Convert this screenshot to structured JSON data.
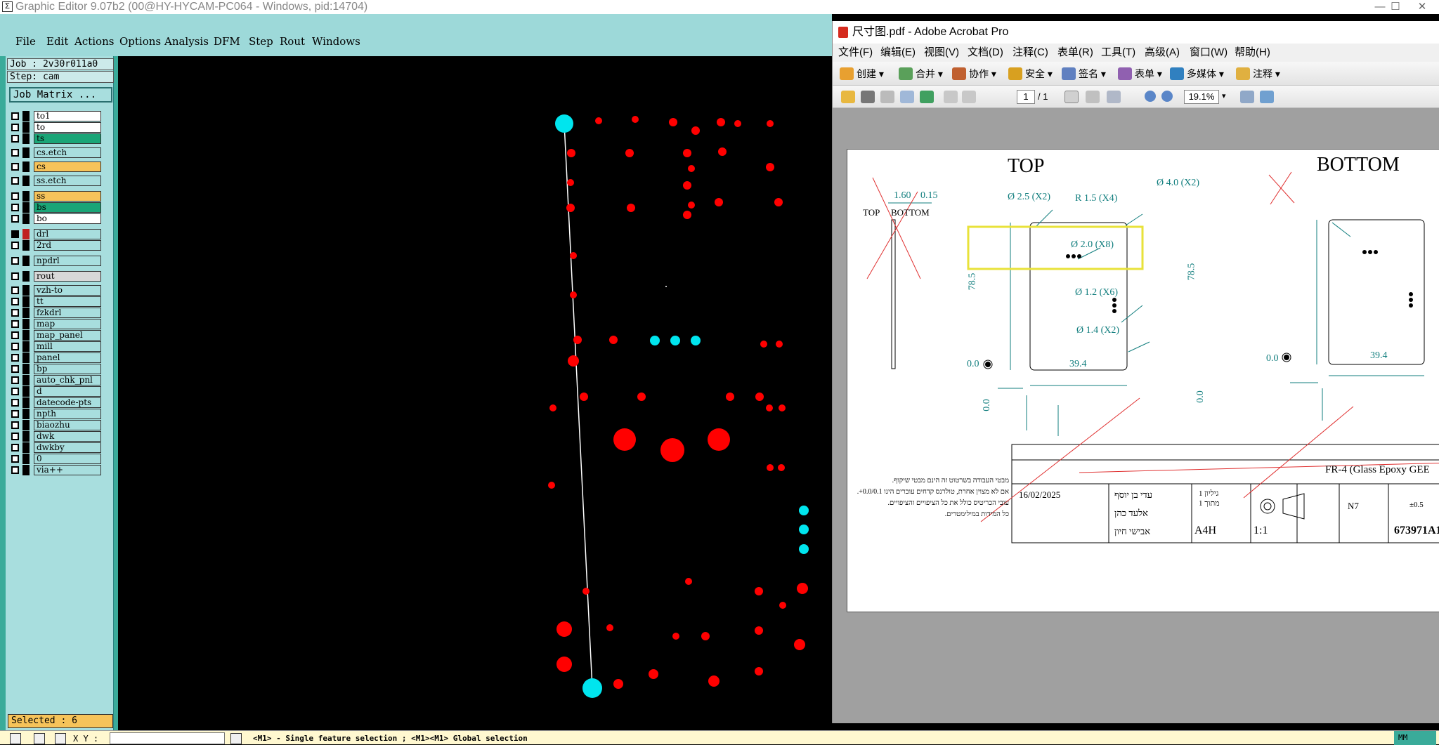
{
  "graphic_editor": {
    "title": "Graphic Editor 9.07b2 (00@HY-HYCAM-PC064 - Windows, pid:14704)",
    "menu": [
      "File",
      "Edit",
      "Actions",
      "Options",
      "Analysis",
      "DFM",
      "Step",
      "Rout",
      "Windows"
    ],
    "job": "Job : 2v30r011a0",
    "step": "Step: cam",
    "job_matrix": "Job Matrix ...",
    "layers": [
      {
        "name": "to1",
        "color": "#ffffff"
      },
      {
        "name": "to",
        "color": "#ffffff"
      },
      {
        "name": "ts",
        "color": "#1aa577"
      },
      {
        "name": "cs.etch",
        "color": "#a8dede"
      },
      {
        "name": "cs",
        "color": "#f6c35a"
      },
      {
        "name": "ss.etch",
        "color": "#a8dede"
      },
      {
        "name": "ss",
        "color": "#f6c35a"
      },
      {
        "name": "bs",
        "color": "#1aa577"
      },
      {
        "name": "bo",
        "color": "#ffffff"
      },
      {
        "name": "drl",
        "color": "#a8dede"
      },
      {
        "name": "2rd",
        "color": "#a8dede"
      },
      {
        "name": "npdrl",
        "color": "#a8dede"
      },
      {
        "name": "rout",
        "color": "#d8d8d8"
      },
      {
        "name": "vzh-to",
        "color": "#a8dede"
      },
      {
        "name": "tt",
        "color": "#a8dede"
      },
      {
        "name": "fzkdrl",
        "color": "#a8dede"
      },
      {
        "name": "map",
        "color": "#a8dede"
      },
      {
        "name": "map_panel",
        "color": "#a8dede"
      },
      {
        "name": "mill",
        "color": "#a8dede"
      },
      {
        "name": "panel",
        "color": "#a8dede"
      },
      {
        "name": "bp",
        "color": "#a8dede"
      },
      {
        "name": "auto_chk_pnl",
        "color": "#a8dede"
      },
      {
        "name": "d",
        "color": "#a8dede"
      },
      {
        "name": "datecode-pts",
        "color": "#a8dede"
      },
      {
        "name": "npth",
        "color": "#a8dede"
      },
      {
        "name": "biaozhu",
        "color": "#a8dede"
      },
      {
        "name": "dwk",
        "color": "#a8dede"
      },
      {
        "name": "dwkby",
        "color": "#a8dede"
      },
      {
        "name": "0",
        "color": "#a8dede"
      },
      {
        "name": "via++",
        "color": "#a8dede"
      }
    ],
    "selected": "Selected : 6",
    "xy_label": "X Y :",
    "status": "<M1> - Single feature selection ; <M1><M1> Global selection",
    "corner_label": "MM"
  },
  "acrobat": {
    "title": "尺寸图.pdf - Adobe Acrobat Pro",
    "menu": [
      "文件(F)",
      "编辑(E)",
      "视图(V)",
      "文档(D)",
      "注释(C)",
      "表单(R)",
      "工具(T)",
      "高级(A)",
      "窗口(W)",
      "帮助(H)"
    ],
    "toolbar": [
      "创建",
      "合并",
      "协作",
      "安全",
      "签名",
      "表单",
      "多媒体",
      "注释"
    ],
    "page_current": "1",
    "page_total": "/ 1",
    "zoom": "19.1%",
    "drawing": {
      "top_heading": "TOP",
      "bottom_heading": "BOTTOM",
      "side_top": "TOP",
      "side_bottom": "BOTTOM",
      "thickness_a": "1.60",
      "thickness_b": "0.15",
      "hole_25": "Ø 2.5 (X2)",
      "radius": "R 1.5 (X4)",
      "hole_20": "Ø 2.0 (X8)",
      "hole_12": "Ø 1.2 (X6)",
      "hole_14": "Ø 1.4 (X2)",
      "hole_40": "Ø 4.0 (X2)",
      "height": "78.5",
      "width": "39.4",
      "origin": "0.0",
      "material": "FR-4 (Glass Epoxy GEE",
      "date": "16/02/2025",
      "name1": "עדי בן יוסף",
      "name2": "אלעד כהן",
      "name3": "אבישי חיון",
      "finish": "N7",
      "sheet_size": "A4H",
      "scale": "1:1",
      "part_no": "673971A1",
      "note1": "מבטי העבודה בשרטוט זה הינם מבטי שיקוף.",
      "note2": "אם לא מצוין אחרת, טולרנס קדחים עוברים הינו 0.0/0.1+.",
      "note3": "עובי הכריטיס כולל את כל הציפויים והציפויים.",
      "note4": "כל המידות במילימטרים.",
      "sheet": "גיליון 1",
      "of": "מתוך 1",
      "general_tol": "±0.5"
    }
  },
  "colors": {
    "teal_bg": "#9dd9d9",
    "panel_green": "#3aab9a",
    "pad_red": "#ff0000",
    "pad_cyan": "#00e5ee",
    "dim_teal": "#0f7d7d",
    "highlight_yellow": "#e8e23a"
  }
}
